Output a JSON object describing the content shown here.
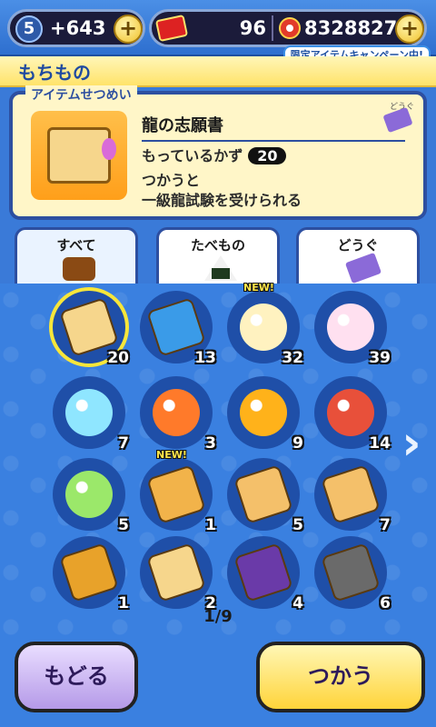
{
  "topbar": {
    "level": "5",
    "money": "+643",
    "tickets": "96",
    "coins": "8328827",
    "plus": "+",
    "campaign": "限定アイテムキャンペーン中!"
  },
  "header": {
    "title": "もちもの"
  },
  "detail": {
    "label": "アイテムせつめい",
    "category_tag": "どうぐ",
    "name": "龍の志願書",
    "count_label": "もっているかず",
    "count": "20",
    "description": "つかうと\n一級龍試験を受けられる"
  },
  "tabs": [
    {
      "label": "すべて",
      "active": true
    },
    {
      "label": "たべもの",
      "active": false
    },
    {
      "label": "どうぐ",
      "active": false
    }
  ],
  "grid": {
    "items": [
      {
        "qty": "20",
        "new": "",
        "selected": true,
        "color": "#f6d68c",
        "icon": "dragon-scroll-icon"
      },
      {
        "qty": "13",
        "new": "",
        "color": "#3a9be8",
        "icon": "book-icon"
      },
      {
        "qty": "32",
        "new": "NEW!",
        "color": "#fff2c0",
        "icon": "orb-icon"
      },
      {
        "qty": "39",
        "new": "",
        "color": "#ffe0f0",
        "icon": "orb-icon"
      },
      {
        "qty": "7",
        "new": "",
        "color": "#8fe6ff",
        "icon": "orb-icon"
      },
      {
        "qty": "3",
        "new": "",
        "color": "#ff7a2a",
        "icon": "orb-icon"
      },
      {
        "qty": "9",
        "new": "",
        "color": "#ffb21a",
        "icon": "flame-icon"
      },
      {
        "qty": "14",
        "new": "",
        "color": "#e8503a",
        "icon": "orb-stand-icon"
      },
      {
        "qty": "5",
        "new": "",
        "color": "#9be86a",
        "icon": "orb-stand-icon"
      },
      {
        "qty": "1",
        "new": "NEW!",
        "color": "#f2b34a",
        "icon": "book-icon"
      },
      {
        "qty": "5",
        "new": "",
        "color": "#f4c06a",
        "icon": "book-icon"
      },
      {
        "qty": "7",
        "new": "",
        "color": "#f4c06a",
        "icon": "book-icon"
      },
      {
        "qty": "1",
        "new": "",
        "color": "#e8a22a",
        "icon": "book-icon"
      },
      {
        "qty": "2",
        "new": "",
        "color": "#f6d68c",
        "icon": "scroll-icon"
      },
      {
        "qty": "4",
        "new": "",
        "color": "#6a3aa8",
        "icon": "book-icon"
      },
      {
        "qty": "6",
        "new": "",
        "color": "#6a6a6a",
        "icon": "stone-icon"
      }
    ],
    "page": "1/9"
  },
  "buttons": {
    "back": "もどる",
    "use": "つかう"
  },
  "nav": {
    "next_arrow": "›"
  }
}
